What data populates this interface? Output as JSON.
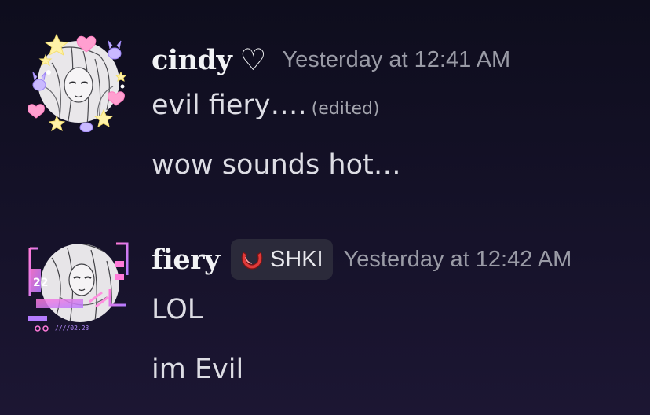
{
  "messages": [
    {
      "author": "cindy",
      "author_suffix": "♡",
      "timestamp": "Yesterday at 12:41 AM",
      "lines": [
        {
          "text": "evil fiery….",
          "edited": "(edited)"
        },
        {
          "text": "wow sounds hot…"
        }
      ],
      "avatar_icon": "anime-avatar-with-stars-icon"
    },
    {
      "author": "fiery",
      "tag": {
        "label": "SHKI",
        "icon": "red-ring-icon"
      },
      "timestamp": "Yesterday at 12:42 AM",
      "lines": [
        {
          "text": "LOL"
        },
        {
          "text": "im Evil"
        }
      ],
      "avatar_icon": "anime-avatar-with-pink-frame-icon"
    }
  ],
  "colors": {
    "background": "#141127",
    "username": "#f2f3f5",
    "timestamp": "#9a9ba6",
    "message_text": "#dddde4",
    "tag_bg": "#2b2a3a",
    "accent_pink": "#e86bd0"
  }
}
